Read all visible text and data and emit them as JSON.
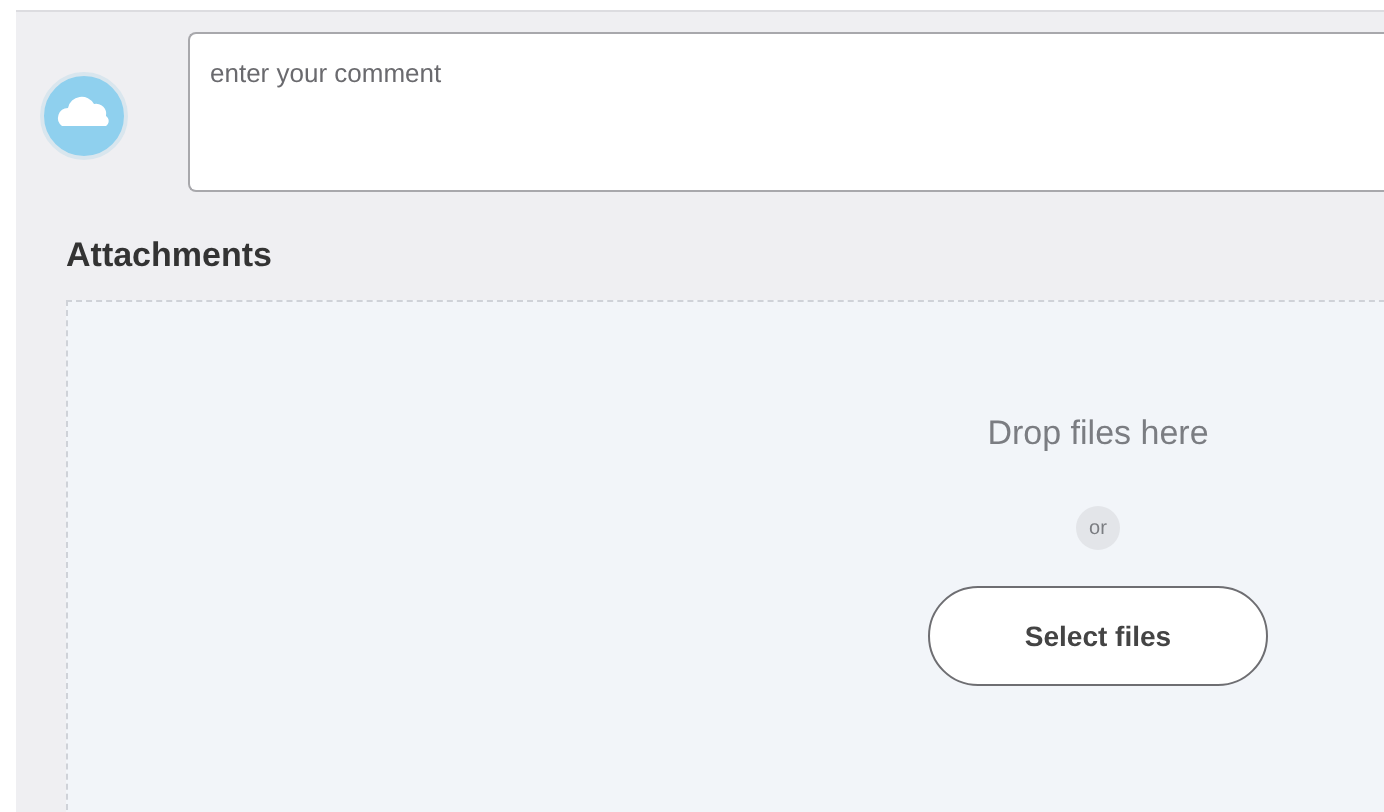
{
  "comment": {
    "placeholder": "enter your comment"
  },
  "attachments": {
    "title": "Attachments",
    "drop_text": "Drop files here",
    "separator": "or",
    "button": "Select files"
  }
}
